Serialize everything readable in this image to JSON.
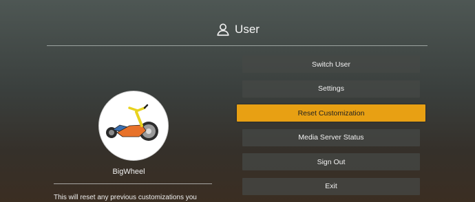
{
  "header": {
    "title": "User",
    "icon": "user-icon"
  },
  "profile": {
    "username": "BigWheel",
    "avatar_icon": "tricycle-icon",
    "description": "This will reset any previous customizations you"
  },
  "menu": {
    "items": [
      {
        "label": "Switch User",
        "selected": false
      },
      {
        "label": "Settings",
        "selected": false
      },
      {
        "label": "Reset Customization",
        "selected": true
      },
      {
        "label": "Media Server Status",
        "selected": false
      },
      {
        "label": "Sign Out",
        "selected": false
      },
      {
        "label": "Exit",
        "selected": false
      }
    ]
  },
  "colors": {
    "accent": "#e8a013",
    "button_bg": "#464846",
    "text": "#f2f2f2"
  }
}
